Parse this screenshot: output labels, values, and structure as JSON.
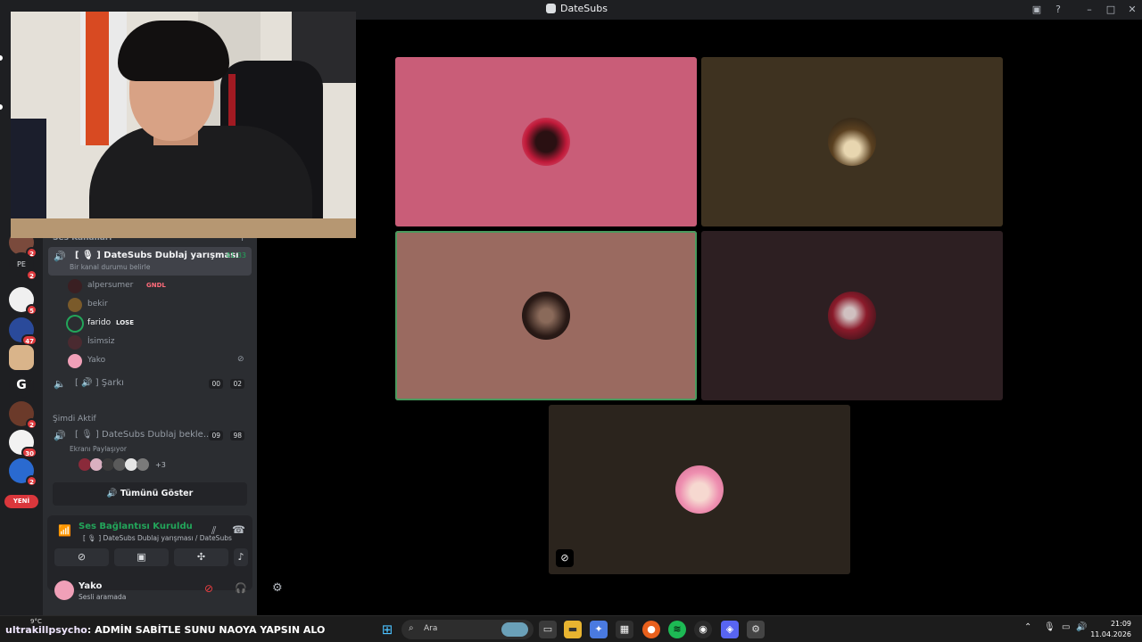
{
  "window": {
    "title": "DateSubs"
  },
  "rail": {
    "badges": [
      "2",
      "2",
      "5",
      "47",
      "2",
      "30",
      "2"
    ],
    "pe_label": "PE",
    "new_label": "YENİ"
  },
  "channels": {
    "voice_header": "Ses Kanalları",
    "active_channel": {
      "name": "[ 🎙 ] DateSubs Dublaj yarışması",
      "timer": "41:33",
      "status_hint": "Bir kanal durumu belirle"
    },
    "members": [
      {
        "name": "alpersumer",
        "tag": "GNDL"
      },
      {
        "name": "bekir"
      },
      {
        "name": "farido",
        "tag": "LOSE"
      },
      {
        "name": "İsimsiz"
      },
      {
        "name": "Yako"
      }
    ],
    "song_channel": {
      "name": "[ 🔊 ] Şarkı",
      "count_a": "00",
      "count_b": "02"
    },
    "now_active_header": "Şimdi Aktif",
    "other_channel": {
      "name": "[ 🎙 ] DateSubs Dublaj bekle...",
      "count_a": "09",
      "count_b": "98",
      "sub": "Ekranı Paylaşıyor",
      "extra": "+3"
    },
    "show_all": "Tümünü Göster"
  },
  "connection": {
    "title": "Ses Bağlantısı Kuruldu",
    "sub": "[ 🎙 ] DateSubs Dublaj yarışması / DateSubs"
  },
  "user": {
    "name": "Yako",
    "status": "Sesli aramada"
  },
  "tiles": [
    {
      "bg": "#c95d78",
      "speaking": false
    },
    {
      "bg": "#3e3220",
      "speaking": false
    },
    {
      "bg": "#9a6a60",
      "speaking": true
    },
    {
      "bg": "#2d1f22",
      "speaking": false
    },
    {
      "bg": "#2b241d",
      "speaking": false,
      "muted": true
    }
  ],
  "taskbar": {
    "chat_user": "ultrakillpsycho",
    "chat_message": ": ADMİN SABİTLE SUNU NAOYA YAPSIN ALO",
    "weather": "9°C",
    "search_placeholder": "Ara",
    "time": "21:09",
    "date": "11.04.2026"
  }
}
